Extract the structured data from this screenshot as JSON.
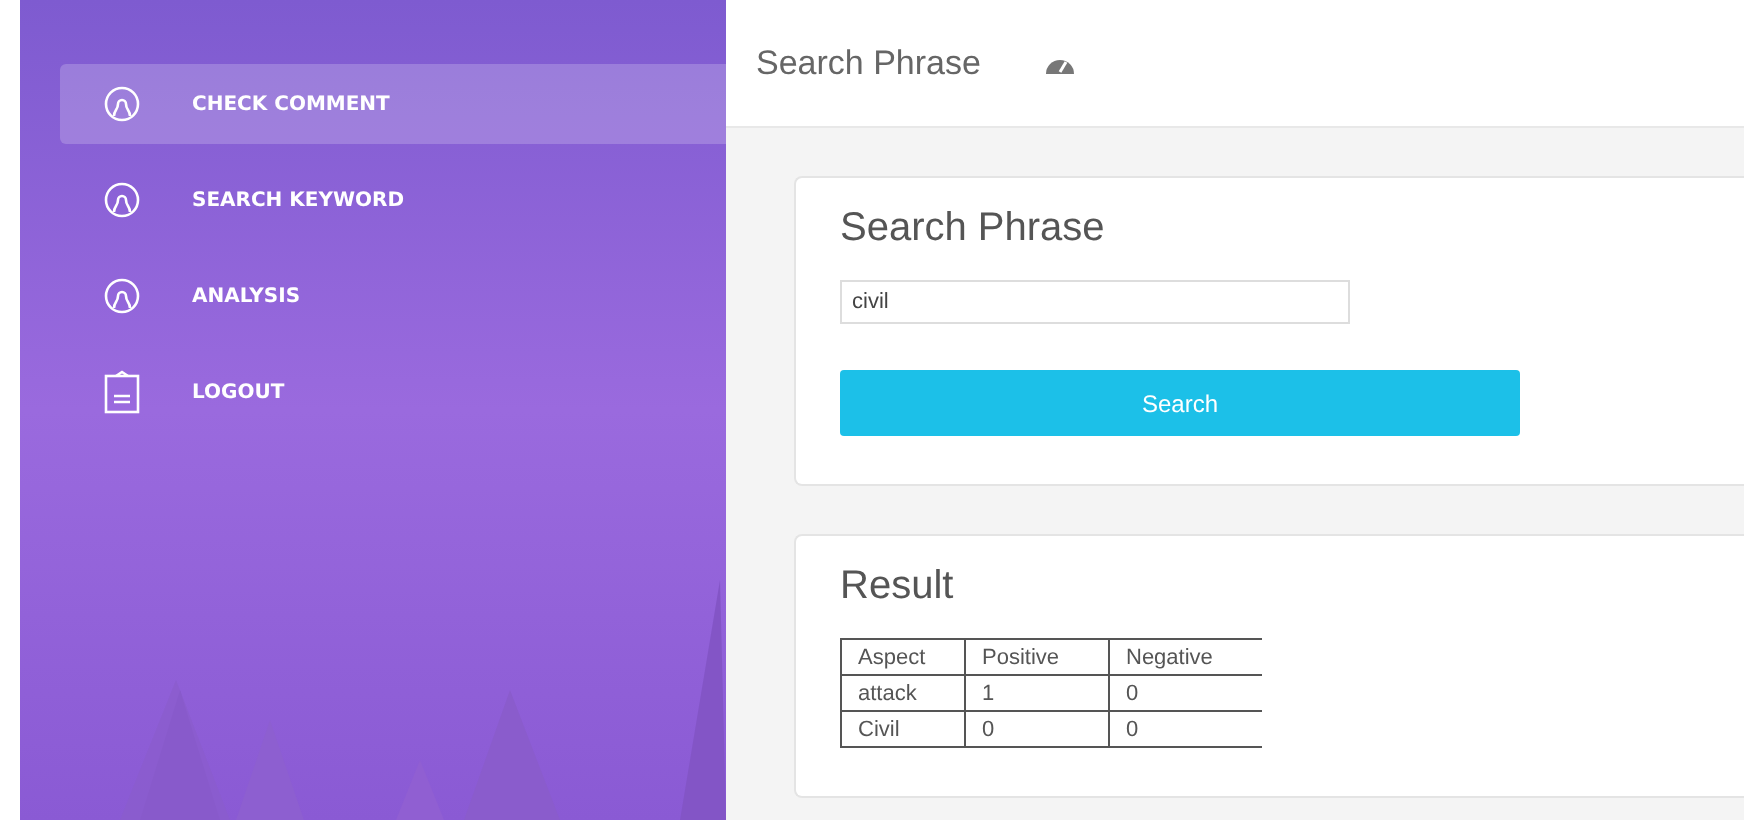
{
  "sidebar": {
    "items": [
      {
        "label": "CHECK COMMENT",
        "kind": "page",
        "selected": true
      },
      {
        "label": "SEARCH KEYWORD",
        "kind": "page",
        "selected": false
      },
      {
        "label": "ANALYSIS",
        "kind": "page",
        "selected": false
      },
      {
        "label": "LOGOUT",
        "kind": "logout",
        "selected": false
      }
    ]
  },
  "header": {
    "title": "Search Phrase"
  },
  "search_card": {
    "title": "Search Phrase",
    "input": {
      "value": "civil"
    },
    "button": "Search"
  },
  "result_card": {
    "title": "Result",
    "table": {
      "columns": [
        "Aspect",
        "Positive",
        "Negative"
      ],
      "rows": [
        [
          "attack",
          "1",
          "0"
        ],
        [
          "Civil",
          "0",
          "0"
        ]
      ]
    }
  }
}
